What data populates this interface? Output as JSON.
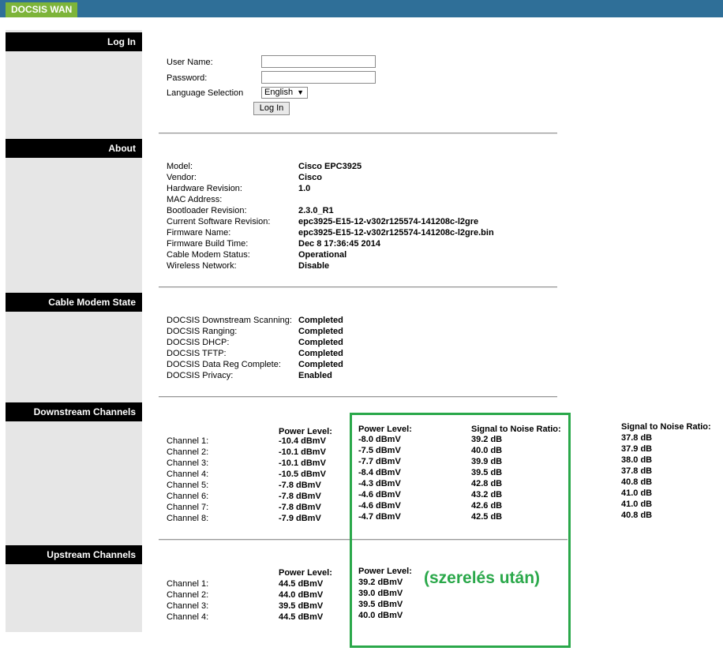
{
  "tab": "DOCSIS WAN",
  "sections": {
    "login": "Log In",
    "about": "About",
    "state": "Cable Modem State",
    "downstream": "Downstream Channels",
    "upstream": "Upstream Channels"
  },
  "login": {
    "username_label": "User Name:",
    "password_label": "Password:",
    "language_label": "Language Selection",
    "language_value": "English",
    "button": "Log In"
  },
  "about": [
    {
      "label": "Model:",
      "value": "Cisco EPC3925"
    },
    {
      "label": "Vendor:",
      "value": "Cisco"
    },
    {
      "label": "Hardware Revision:",
      "value": "1.0"
    },
    {
      "label": "MAC Address:",
      "value": ""
    },
    {
      "label": "Bootloader Revision:",
      "value": "2.3.0_R1"
    },
    {
      "label": "Current Software Revision:",
      "value": "epc3925-E15-12-v302r125574-141208c-l2gre"
    },
    {
      "label": "Firmware Name:",
      "value": "epc3925-E15-12-v302r125574-141208c-l2gre.bin"
    },
    {
      "label": "Firmware Build Time:",
      "value": "Dec 8 17:36:45 2014"
    },
    {
      "label": "Cable Modem Status:",
      "value": "Operational"
    },
    {
      "label": "Wireless Network:",
      "value": "Disable"
    }
  ],
  "state": [
    {
      "label": "DOCSIS Downstream Scanning:",
      "value": "Completed"
    },
    {
      "label": "DOCSIS Ranging:",
      "value": "Completed"
    },
    {
      "label": "DOCSIS DHCP:",
      "value": "Completed"
    },
    {
      "label": "DOCSIS TFTP:",
      "value": "Completed"
    },
    {
      "label": "DOCSIS Data Reg Complete:",
      "value": "Completed"
    },
    {
      "label": "DOCSIS Privacy:",
      "value": "Enabled"
    }
  ],
  "downstream": {
    "power_header": "Power Level:",
    "snr_header": "Signal to Noise Ratio:",
    "channels": [
      "Channel 1:",
      "Channel 2:",
      "Channel 3:",
      "Channel 4:",
      "Channel 5:",
      "Channel 6:",
      "Channel 7:",
      "Channel 8:"
    ],
    "power_before": [
      "-10.4 dBmV",
      "-10.1 dBmV",
      "-10.1 dBmV",
      "-10.5 dBmV",
      "-7.8 dBmV",
      "-7.8 dBmV",
      "-7.8 dBmV",
      "-7.9 dBmV"
    ],
    "power_after": [
      "-8.0 dBmV",
      "-7.5 dBmV",
      "-7.7 dBmV",
      "-8.4 dBmV",
      "-4.3 dBmV",
      "-4.6 dBmV",
      "-4.6 dBmV",
      "-4.7 dBmV"
    ],
    "snr_after": [
      "39.2 dB",
      "40.0 dB",
      "39.9 dB",
      "39.5 dB",
      "42.8 dB",
      "43.2 dB",
      "42.6 dB",
      "42.5 dB"
    ],
    "snr_before": [
      "37.8 dB",
      "37.9 dB",
      "38.0 dB",
      "37.8 dB",
      "40.8 dB",
      "41.0 dB",
      "41.0 dB",
      "40.8 dB"
    ]
  },
  "upstream": {
    "power_header": "Power Level:",
    "channels": [
      "Channel 1:",
      "Channel 2:",
      "Channel 3:",
      "Channel 4:"
    ],
    "power_before": [
      "44.5 dBmV",
      "44.0 dBmV",
      "39.5 dBmV",
      "44.5 dBmV"
    ],
    "power_after": [
      "39.2 dBmV",
      "39.0 dBmV",
      "39.5 dBmV",
      "40.0 dBmV"
    ]
  },
  "annotation": "(szerelés után)",
  "colors": {
    "tab": "#7db43a",
    "topbar": "#2f6f98",
    "highlight": "#2aa84a"
  }
}
